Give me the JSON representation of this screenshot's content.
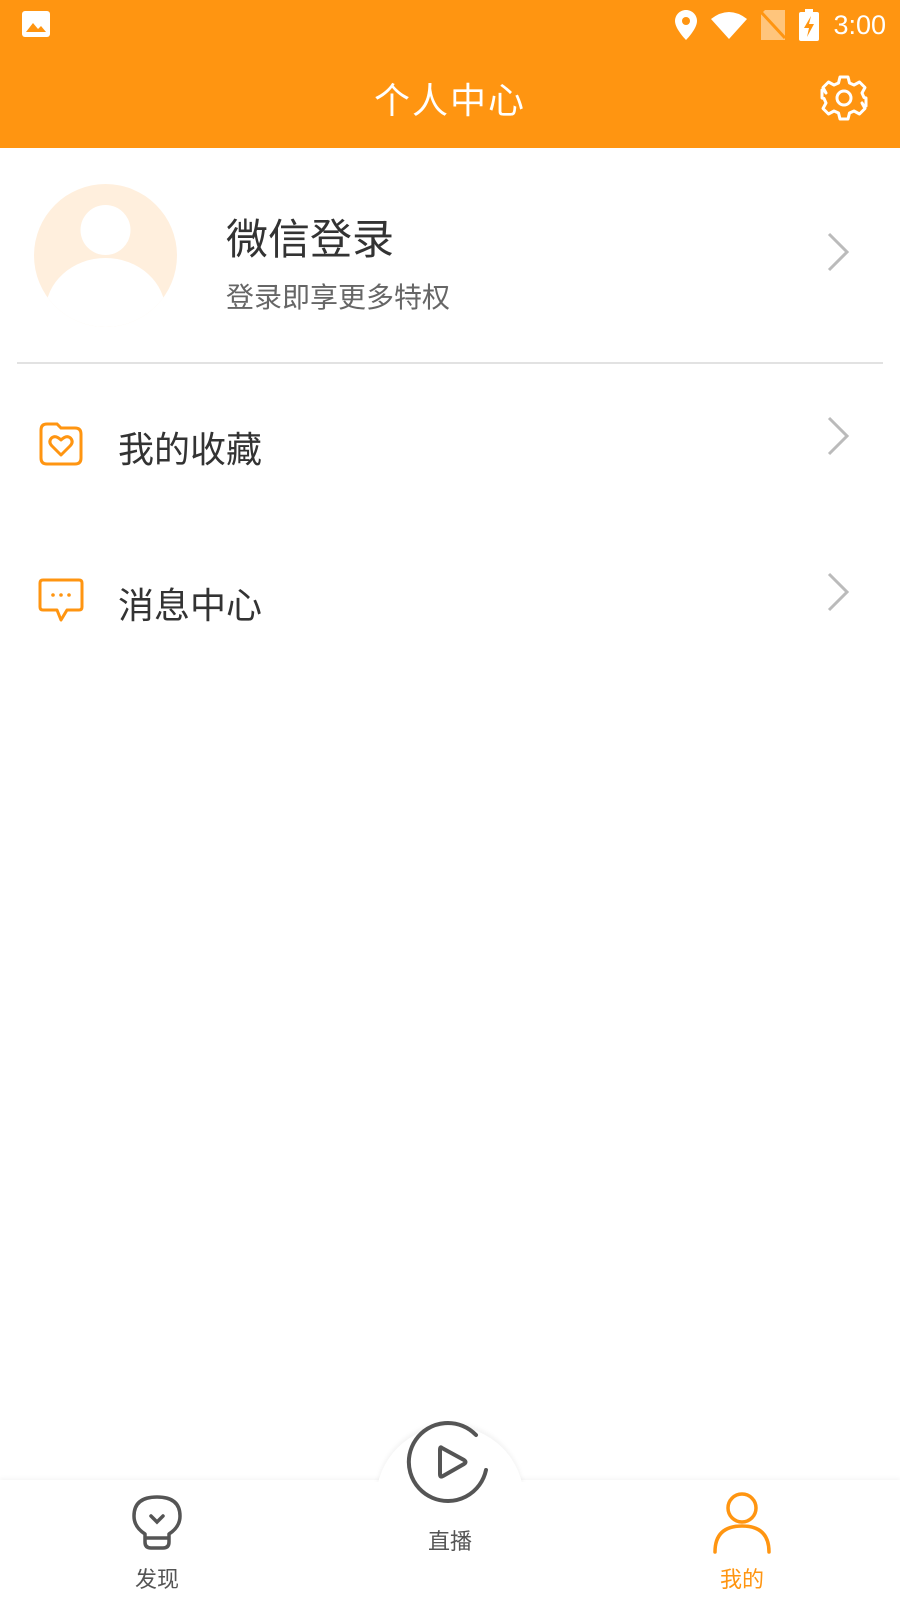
{
  "status_bar": {
    "time": "3:00",
    "icons": [
      "image-icon",
      "location-icon",
      "wifi-icon",
      "no-sim-icon",
      "battery-charging-icon"
    ]
  },
  "header": {
    "title": "个人中心",
    "settings_icon": "gear-icon"
  },
  "profile": {
    "avatar_icon": "user-avatar-placeholder-icon",
    "login_title": "微信登录",
    "login_subtitle": "登录即享更多特权"
  },
  "menu": [
    {
      "label": "我的收藏",
      "icon": "heart-folder-icon"
    },
    {
      "label": "消息中心",
      "icon": "chat-bubble-icon"
    }
  ],
  "bottom_nav": {
    "items": [
      {
        "label": "发现",
        "icon": "lightbulb-icon",
        "active": false
      },
      {
        "label": "直播",
        "icon": "play-circle-icon",
        "active": false
      },
      {
        "label": "我的",
        "icon": "person-icon",
        "active": true
      }
    ]
  },
  "colors": {
    "accent": "#FF9511",
    "text": "#333333",
    "subtext": "#666666",
    "inactive_nav": "#555555",
    "divider": "#E2E2E2",
    "avatar_bg": "#FFEFDD"
  }
}
